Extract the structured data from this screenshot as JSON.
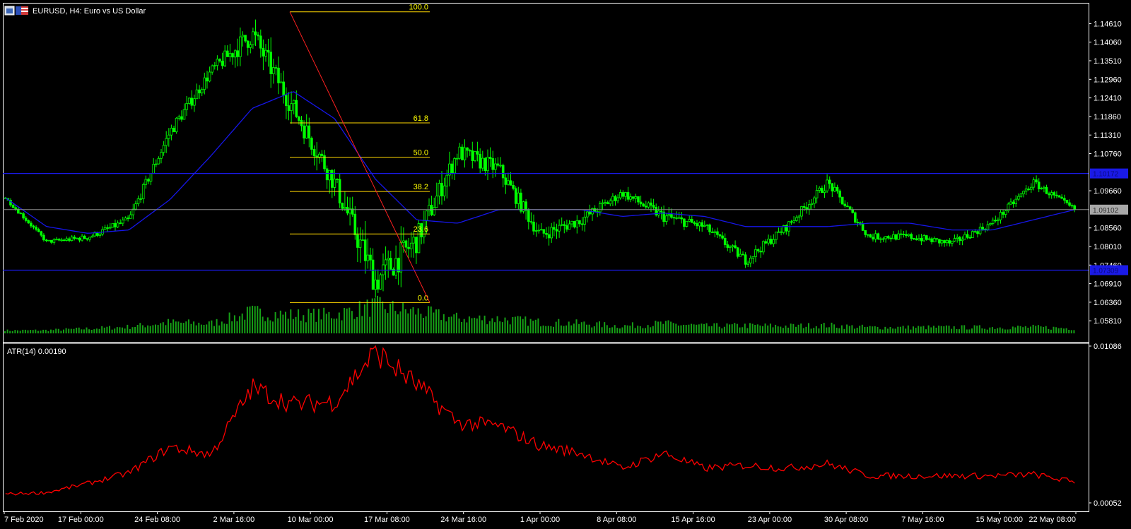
{
  "window": {
    "title": "EURUSD, H4:  Euro vs US Dollar",
    "icons": [
      "window-restore-icon",
      "eu-flag-icon",
      "us-flag-icon"
    ]
  },
  "colors": {
    "background": "#000000",
    "candles": "#00ff00",
    "moving_average": "#1616e8",
    "atr_line": "#ff0000",
    "fibonacci": "#ffd700",
    "horizontal_lines": "#1a1ae6",
    "price_line": "#8a8a8a",
    "volumes": "#16a016",
    "axis": "#ffffff"
  },
  "indicator": {
    "label": "ATR(14) 0.00190"
  },
  "price_tags": {
    "current": "1.09102",
    "upper_line": "1.10172",
    "lower_line": "1.07309"
  },
  "chart_data": [
    {
      "type": "line",
      "panel": "main",
      "title": "EURUSD, H4:  Euro vs US Dollar",
      "series_style": "candlestick",
      "y_ticks": [
        "1.14610",
        "1.14060",
        "1.13510",
        "1.12960",
        "1.12410",
        "1.11860",
        "1.11310",
        "1.10760",
        "1.09660",
        "1.08560",
        "1.08010",
        "1.07460",
        "1.06910",
        "1.06360",
        "1.05810"
      ],
      "x_ticks": [
        "7 Feb 2020",
        "17 Feb 00:00",
        "24 Feb 08:00",
        "2 Mar 16:00",
        "10 Mar 00:00",
        "17 Mar 08:00",
        "24 Mar 16:00",
        "1 Apr 00:00",
        "8 Apr 08:00",
        "15 Apr 16:00",
        "23 Apr 00:00",
        "30 Apr 08:00",
        "7 May 16:00",
        "15 May 00:00",
        "22 May 08:00"
      ],
      "ylim": [
        1.0548,
        1.151
      ],
      "x": [
        "7 Feb",
        "17 Feb",
        "24 Feb",
        "28 Feb",
        "2 Mar",
        "6 Mar",
        "9 Mar",
        "12 Mar",
        "17 Mar",
        "20 Mar",
        "24 Mar",
        "27 Mar",
        "1 Apr",
        "6 Apr",
        "8 Apr",
        "13 Apr",
        "15 Apr",
        "20 Apr",
        "23 Apr",
        "28 Apr",
        "30 Apr",
        "4 May",
        "7 May",
        "12 May",
        "15 May",
        "19 May",
        "22 May"
      ],
      "close": [
        1.0945,
        1.0815,
        1.0828,
        1.088,
        1.114,
        1.132,
        1.143,
        1.121,
        1.099,
        1.07,
        1.082,
        1.108,
        1.103,
        1.0835,
        1.088,
        1.096,
        1.089,
        1.086,
        1.076,
        1.086,
        1.099,
        1.083,
        1.083,
        1.081,
        1.087,
        1.099,
        1.091
      ],
      "moving_average": [
        1.0945,
        1.086,
        1.084,
        1.085,
        1.094,
        1.107,
        1.121,
        1.126,
        1.118,
        1.1,
        1.088,
        1.087,
        1.091,
        1.091,
        1.091,
        1.089,
        1.09,
        1.089,
        1.086,
        1.086,
        1.086,
        1.087,
        1.087,
        1.085,
        1.085,
        1.088,
        1.091
      ],
      "fibonacci": {
        "levels": [
          "100.0",
          "61.8",
          "50.0",
          "38.2",
          "23.6",
          "0.0"
        ],
        "high": 1.1496,
        "low": 1.0635
      },
      "horizontal_lines": [
        1.10172,
        1.07309
      ],
      "current_price": 1.09102
    },
    {
      "type": "line",
      "panel": "indicator",
      "title": "ATR(14) 0.00190",
      "y_ticks": [
        "0.01086",
        "0.00052"
      ],
      "ylim": [
        0.00052,
        0.01086
      ],
      "x": [
        "7 Feb",
        "17 Feb",
        "24 Feb",
        "28 Feb",
        "2 Mar",
        "6 Mar",
        "9 Mar",
        "12 Mar",
        "17 Mar",
        "20 Mar",
        "24 Mar",
        "27 Mar",
        "1 Apr",
        "6 Apr",
        "8 Apr",
        "13 Apr",
        "15 Apr",
        "20 Apr",
        "23 Apr",
        "28 Apr",
        "30 Apr",
        "4 May",
        "7 May",
        "12 May",
        "15 May",
        "19 May",
        "22 May"
      ],
      "values": [
        0.0011,
        0.0012,
        0.0018,
        0.0025,
        0.0042,
        0.0037,
        0.0081,
        0.007,
        0.0072,
        0.0105,
        0.0083,
        0.0058,
        0.0056,
        0.0043,
        0.0038,
        0.0028,
        0.0038,
        0.0028,
        0.003,
        0.0028,
        0.0031,
        0.0023,
        0.0023,
        0.0023,
        0.0023,
        0.0024,
        0.0019
      ]
    }
  ]
}
